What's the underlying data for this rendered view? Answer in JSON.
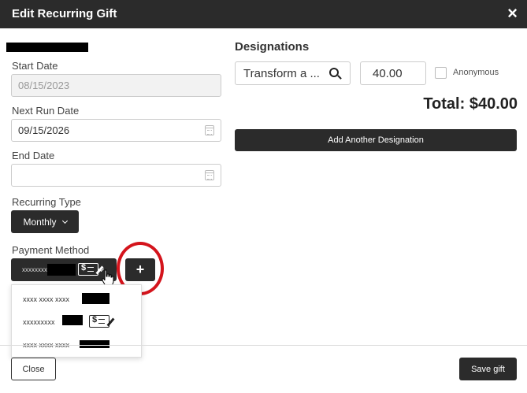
{
  "modal": {
    "title": "Edit Recurring Gift",
    "close_symbol": "×"
  },
  "form": {
    "start_date_label": "Start Date",
    "start_date_value": "08/15/2023",
    "next_run_label": "Next Run Date",
    "next_run_value": "09/15/2026",
    "end_date_label": "End Date",
    "end_date_value": "",
    "recurring_type_label": "Recurring Type",
    "recurring_type_value": "Monthly",
    "payment_method_label": "Payment Method",
    "payment_method_value": "xxxxxxxx",
    "add_payment_symbol": "+"
  },
  "payment_options": [
    {
      "text": "xxxx xxxx xxxx",
      "icon": "check-icon-none"
    },
    {
      "text": "xxxxxxxxx",
      "icon": "check-icon"
    },
    {
      "text": "xxxx xxxx xxxx",
      "icon": "check-icon-none"
    }
  ],
  "designations": {
    "heading": "Designations",
    "search_value": "Transform a ...",
    "amount_value": "40.00",
    "anonymous_label": "Anonymous",
    "total_text": "Total: $40.00",
    "add_button_label": "Add Another Designation"
  },
  "footer": {
    "close_label": "Close",
    "save_label": "Save gift"
  },
  "colors": {
    "header_bg": "#2b2b2b",
    "annotation_circle": "#d4141c"
  }
}
